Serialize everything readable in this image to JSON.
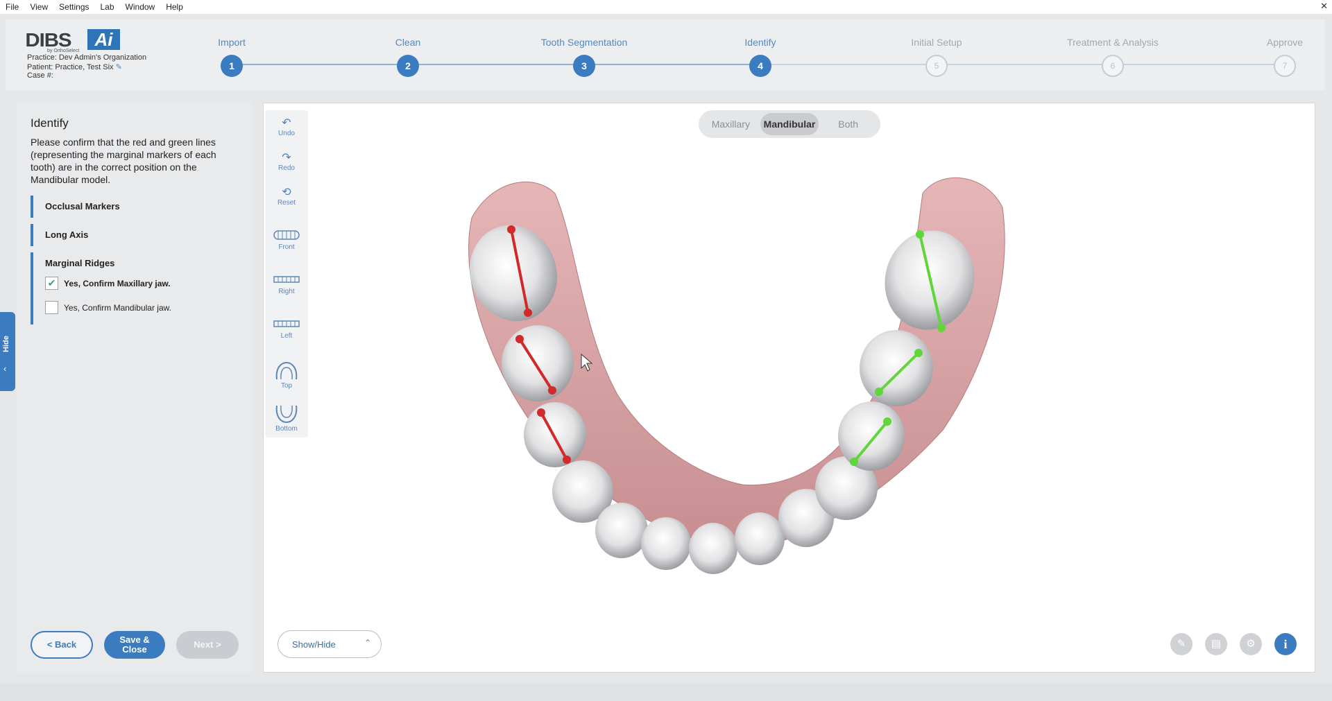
{
  "menu": [
    "File",
    "View",
    "Settings",
    "Lab",
    "Window",
    "Help"
  ],
  "window": {
    "close": "✕"
  },
  "brand": {
    "name": "DIBS",
    "ai": "Ai",
    "sub": "by OrthoSelect"
  },
  "case_info": {
    "practice": "Practice: Dev Admin's Organization",
    "patient": "Patient: Practice, Test Six",
    "case": "Case #:"
  },
  "steps": [
    {
      "label": "Import",
      "num": "1",
      "state": "done"
    },
    {
      "label": "Clean",
      "num": "2",
      "state": "done"
    },
    {
      "label": "Tooth Segmentation",
      "num": "3",
      "state": "done"
    },
    {
      "label": "Identify",
      "num": "4",
      "state": "current"
    },
    {
      "label": "Initial Setup",
      "num": "5",
      "state": "pending"
    },
    {
      "label": "Treatment & Analysis",
      "num": "6",
      "state": "pending"
    },
    {
      "label": "Approve",
      "num": "7",
      "state": "pending"
    }
  ],
  "panel": {
    "title": "Identify",
    "description": "Please confirm that the red and green lines (representing the marginal markers of each tooth) are in the correct position on the Mandibular model.",
    "sections": [
      "Occlusal Markers",
      "Long Axis",
      "Marginal Ridges"
    ],
    "checks": [
      {
        "label": "Yes, Confirm Maxillary jaw.",
        "checked": true
      },
      {
        "label": "Yes, Confirm Mandibular jaw.",
        "checked": false
      }
    ],
    "back": "<  Back",
    "save_line1": "Save &",
    "save_line2": "Close",
    "next": "Next  >"
  },
  "hide_tab": {
    "label": "Hide",
    "chevron": "‹"
  },
  "tools": [
    {
      "label": "Undo",
      "icon": "undo-icon"
    },
    {
      "label": "Redo",
      "icon": "redo-icon"
    },
    {
      "label": "Reset",
      "icon": "reset-icon"
    },
    {
      "label": "Front",
      "icon": "front-view-icon"
    },
    {
      "label": "Right",
      "icon": "right-view-icon"
    },
    {
      "label": "Left",
      "icon": "left-view-icon"
    },
    {
      "label": "Top",
      "icon": "top-view-icon"
    },
    {
      "label": "Bottom",
      "icon": "bottom-view-icon"
    }
  ],
  "jaw_toggle": {
    "options": [
      "Maxillary",
      "Mandibular",
      "Both"
    ],
    "selected": "Mandibular"
  },
  "show_hide": "Show/Hide",
  "colors": {
    "accent": "#3b7cc0",
    "red_marker": "#d22a2a",
    "green_marker": "#5fd63a",
    "gum": "#d9a3a5"
  }
}
